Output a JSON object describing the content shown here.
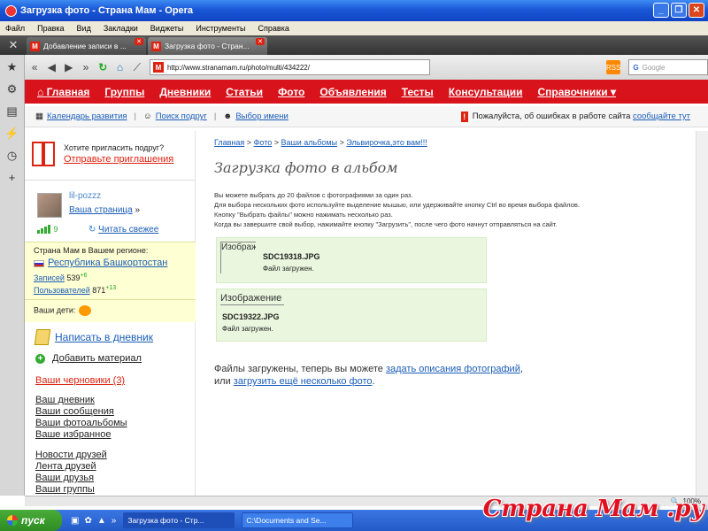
{
  "window": {
    "title": "Загрузка фото - Страна Мам - Opera"
  },
  "menubar": [
    "Файл",
    "Правка",
    "Вид",
    "Закладки",
    "Виджеты",
    "Инструменты",
    "Справка"
  ],
  "tabs": [
    {
      "label": "Добавление записи в ...",
      "active": false
    },
    {
      "label": "Загрузка фото - Стран...",
      "active": true
    }
  ],
  "address": {
    "url": "http://www.stranamam.ru/photo/multi/434222/",
    "search_placeholder": "Google"
  },
  "site_nav": [
    "Главная",
    "Группы",
    "Дневники",
    "Статьи",
    "Фото",
    "Объявления",
    "Тесты",
    "Консультации",
    "Справочники"
  ],
  "subbar": {
    "calendar": "Календарь развития",
    "friends": "Поиск подруг",
    "names": "Выбор имени",
    "warn_text": "Пожалуйста, об ошибках в работе сайта",
    "warn_link": "сообщайте тут"
  },
  "invite": {
    "text": "Хотите пригласить подруг?",
    "link": "Отправьте приглашения"
  },
  "user": {
    "name": "lil-pozzz",
    "page_link": "Ваша страница",
    "rating": "9",
    "fresh": "Читать свежее"
  },
  "region": {
    "title": "Страна Мам в Вашем регионе:",
    "name": "Республика Башкортостан",
    "records_label": "Записей",
    "records": "539",
    "records_new": "+6",
    "users_label": "Пользователей",
    "users": "871",
    "users_new": "+13"
  },
  "kids": {
    "label": "Ваши дети:"
  },
  "left_menu": {
    "write": "Написать в дневник",
    "add": "Добавить материал",
    "drafts": "Ваши черновики",
    "drafts_count": "(3)",
    "group1": [
      "Ваш дневник",
      "Ваши сообщения",
      "Ваши фотоальбомы",
      "Ваше избранное"
    ],
    "group2": [
      "Новости друзей",
      "Лента друзей",
      "Ваши друзья",
      "Ваши группы"
    ]
  },
  "content": {
    "crumbs": [
      "Главная",
      "Фото",
      "Ваши альбомы",
      "Эльвирочка,это вам!!!"
    ],
    "crumb_sep": ">",
    "title": "Загрузка фото в альбом",
    "desc": [
      "Вы можете выбрать до 20 файлов с фотографиями за один раз.",
      "Для выбора нескольких фото используйте выделение мышью, или удерживайте кнопку Ctrl во время выбора файлов.",
      "Кнопку \"Выбрать файлы\" можно нажимать несколько раз.",
      "Когда вы завершите свой выбор, нажимайте кнопку \"Загрузить\", после чего фото начнут отправляться на сайт."
    ],
    "photos": [
      {
        "img_alt": "Изображение",
        "file": "SDC19318.JPG",
        "status": "Файл загружен."
      },
      {
        "img_alt": "Изображение",
        "file": "SDC19322.JPG",
        "status": "Файл загружен."
      }
    ],
    "done_text": "Файлы загружены, теперь вы можете",
    "done_link1": "задать описания фотографий",
    "done_or": "или",
    "done_link2": "загрузить ещё несколько фото"
  },
  "status": {
    "zoom": "100%"
  },
  "taskbar": {
    "start": "пуск",
    "tasks": [
      "Загрузка фото - Стр...",
      "C:\\Documents and Se..."
    ]
  },
  "brand": "Страна Мам .ру",
  "colors": {
    "accent": "#d8131c",
    "link": "#1a5db8",
    "success_bg": "#eaf7de"
  }
}
